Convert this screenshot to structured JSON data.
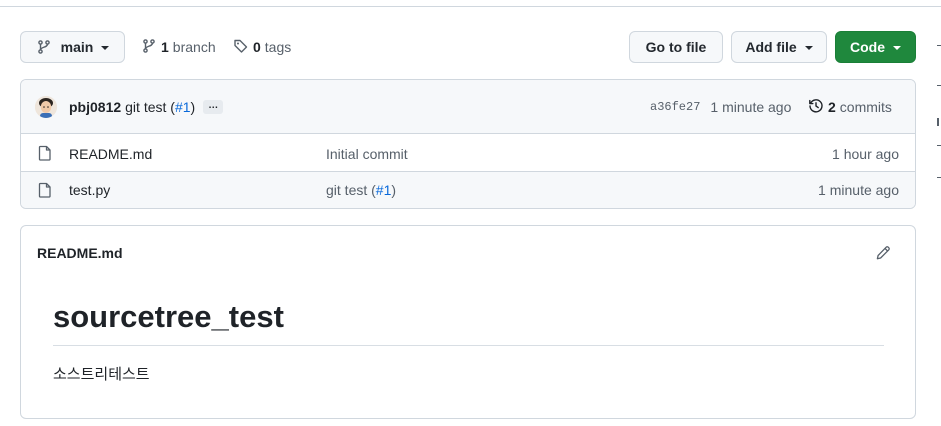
{
  "toolbar": {
    "branch_name": "main",
    "branch_count": "1",
    "branch_label": "branch",
    "tag_count": "0",
    "tag_label": "tags",
    "go_to_file": "Go to file",
    "add_file": "Add file",
    "code": "Code"
  },
  "latest_commit": {
    "author": "pbj0812",
    "message_prefix": "git test (",
    "pr_ref": "#1",
    "message_suffix": ")",
    "ellipsis": "…",
    "sha": "a36fe27",
    "time": "1 minute ago",
    "commit_count": "2",
    "commits_label": "commits"
  },
  "files": [
    {
      "name": "README.md",
      "message": "Initial commit",
      "message_prefix": "",
      "pr_ref": "",
      "message_suffix": "",
      "time": "1 hour ago"
    },
    {
      "name": "test.py",
      "message": "",
      "message_prefix": "git test (",
      "pr_ref": "#1",
      "message_suffix": ")",
      "time": "1 minute ago"
    }
  ],
  "readme": {
    "filename": "README.md",
    "heading": "sourcetree_test",
    "body": "소스트리테스트"
  },
  "colors": {
    "accent_green": "#1f883d",
    "link_blue": "#0969da",
    "border": "#d0d7de",
    "subtle_bg": "#f6f8fa"
  }
}
